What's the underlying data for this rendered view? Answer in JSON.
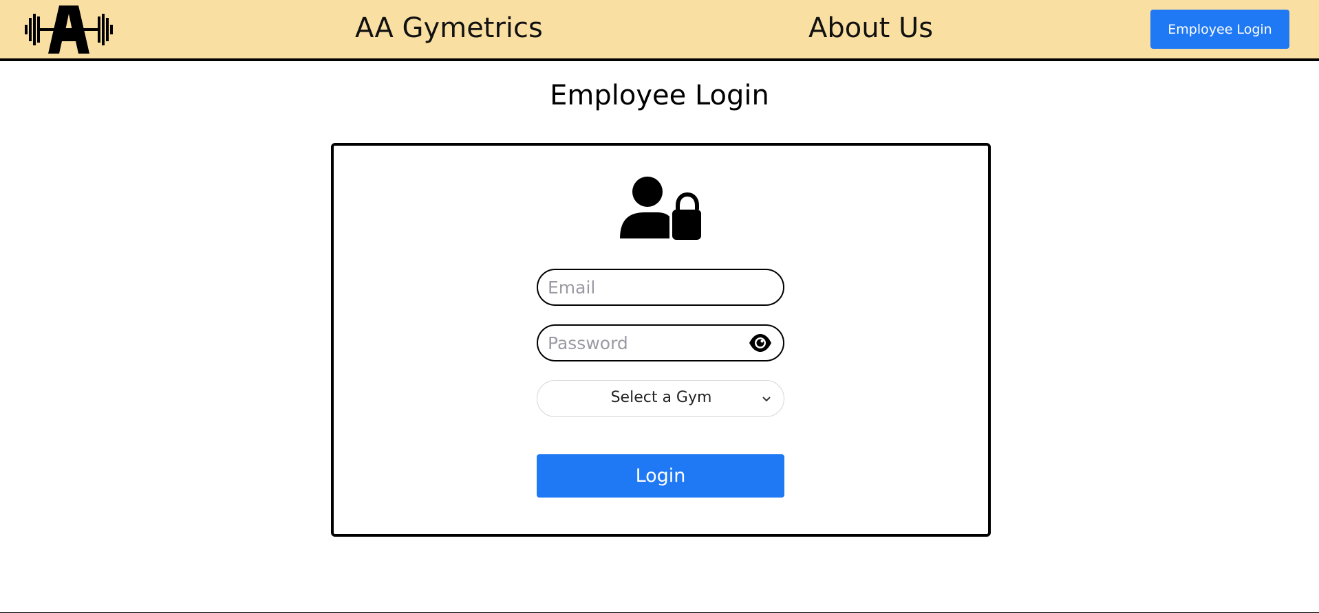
{
  "header": {
    "logo_icon": "dumbbell-a-logo",
    "brand_label": "AA Gymetrics",
    "about_label": "About Us",
    "employee_login_button": "Employee Login",
    "background_color": "#f9dfa2"
  },
  "page": {
    "title": "Employee Login"
  },
  "login_form": {
    "icon": "user-lock-icon",
    "email": {
      "value": "",
      "placeholder": "Email"
    },
    "password": {
      "value": "",
      "placeholder": "Password",
      "toggle_icon": "eye-icon"
    },
    "gym_select": {
      "selected": "Select a Gym",
      "icon": "chevron-down-icon"
    },
    "submit_label": "Login"
  },
  "colors": {
    "accent": "#2079f4",
    "border": "#000000"
  }
}
